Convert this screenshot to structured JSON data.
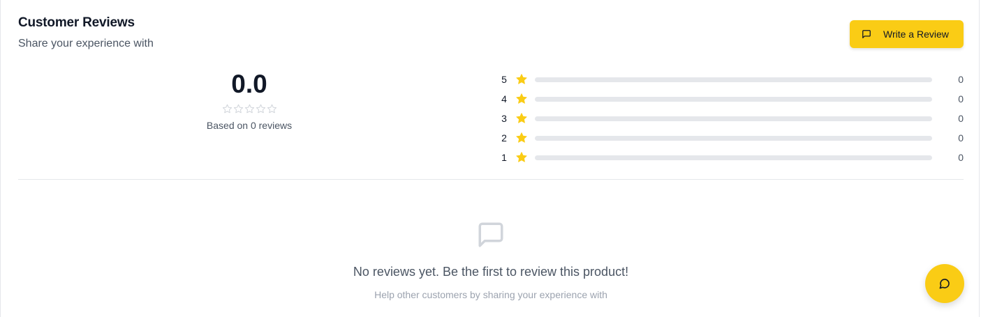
{
  "header": {
    "title": "Customer Reviews",
    "subtitle": "Share your experience with"
  },
  "write_button": {
    "label": "Write a Review",
    "icon": "message-square-icon"
  },
  "summary": {
    "average": "0.0",
    "stars_filled": 0,
    "stars_total": 5,
    "based_on": "Based on 0 reviews"
  },
  "distribution": [
    {
      "stars": "5",
      "count": "0",
      "fraction": 0
    },
    {
      "stars": "4",
      "count": "0",
      "fraction": 0
    },
    {
      "stars": "3",
      "count": "0",
      "fraction": 0
    },
    {
      "stars": "2",
      "count": "0",
      "fraction": 0
    },
    {
      "stars": "1",
      "count": "0",
      "fraction": 0
    }
  ],
  "empty_state": {
    "icon": "message-square-icon",
    "title": "No reviews yet. Be the first to review this product!",
    "subtitle": "Help other customers by sharing your experience with"
  },
  "chat_fab": {
    "icon": "chat-bubble-icon"
  },
  "colors": {
    "accent": "#facc15",
    "star": "#facc15",
    "bar_track": "#e5e7eb",
    "star_empty": "#d1d5db"
  }
}
